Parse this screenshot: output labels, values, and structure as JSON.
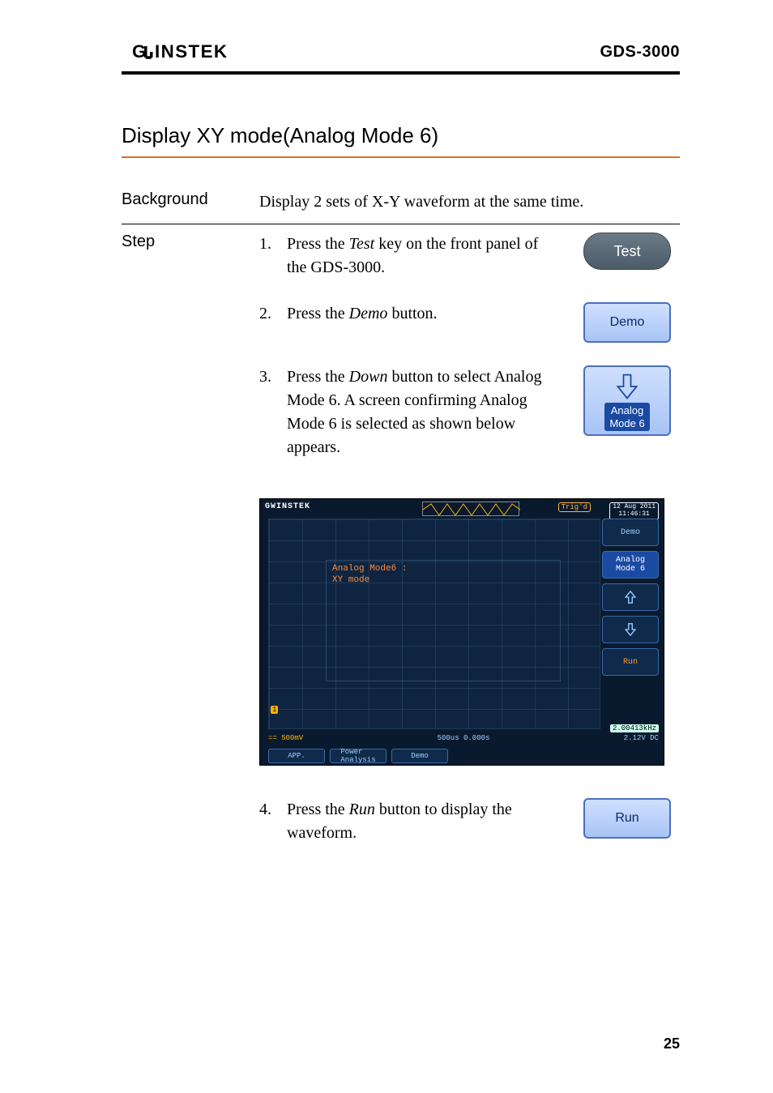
{
  "header": {
    "brand": "GWINSTEK",
    "model": "GDS-3000"
  },
  "section_title": "Display XY mode(Analog Mode 6)",
  "rows": {
    "background": {
      "label": "Background",
      "text": "Display 2 sets of X-Y waveform at the same time."
    },
    "step_label": "Step"
  },
  "steps": {
    "s1a": "Press the ",
    "s1b": "Test",
    "s1c": " key on the front panel of the GDS-3000.",
    "s2a": "Press the ",
    "s2b": "Demo",
    "s2c": " button.",
    "s3a": "Press the ",
    "s3b": "Down",
    "s3c": " button to select Analog Mode 6. A screen confirming Analog Mode 6 is selected as shown below appears.",
    "s4a": "Press the ",
    "s4b": "Run",
    "s4c": " button to display the waveform."
  },
  "buttons": {
    "test": "Test",
    "demo": "Demo",
    "analog_mode6_l1": "Analog",
    "analog_mode6_l2": "Mode 6",
    "run": "Run"
  },
  "scope": {
    "brand": "GWINSTEK",
    "trig": "Trig'd",
    "date": "12 Aug 2011",
    "time": "11:46:31",
    "mode_label_1": "Analog Mode6 :",
    "mode_label_2": "XY mode",
    "side": {
      "demo": "Demo",
      "analog": "Analog\nMode 6",
      "run": "Run"
    },
    "freq": "2.00413kHz",
    "ch_info_left": "== 500mV",
    "ch_info_mid": "500us    0.000s",
    "ch_info_right": "2.12V    DC",
    "soft_row": {
      "app": "APP.",
      "power": "Power\nAnalysis",
      "demo": "Demo"
    }
  },
  "page_number": "25"
}
